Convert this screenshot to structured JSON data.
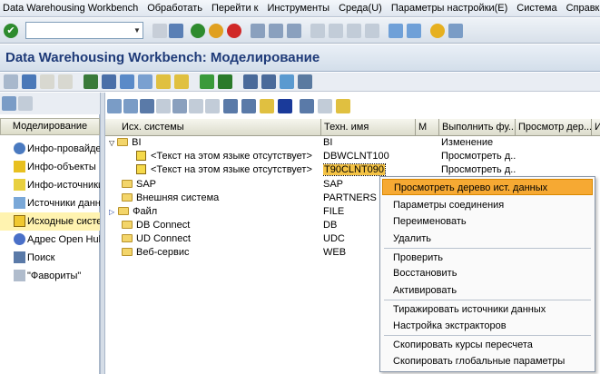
{
  "menu": [
    "Data Warehousing Workbench",
    "Обработать",
    "Перейти к",
    "Инструменты",
    "Среда(U)",
    "Параметры настройки(E)",
    "Система",
    "Справка"
  ],
  "toolbar": {
    "command_value": ""
  },
  "title": "Data Warehousing Workbench: Моделирование",
  "left": {
    "header": "Моделирование",
    "items": [
      "Инфо-провайдер",
      "Инфо-объекты",
      "Инфо-источники",
      "Источники данных",
      "Исходные системы",
      "Адрес Open Hub",
      "Поиск",
      "\"Фавориты\""
    ]
  },
  "grid": {
    "columns": [
      "Исх. системы",
      "Техн. имя",
      "М",
      "Выполнить фу...",
      "Просмотр дер...",
      "И"
    ],
    "rows": [
      {
        "name": "BI",
        "tech": "BI",
        "action": "Изменение"
      },
      {
        "name": "<Текст на этом языке отсутствует>",
        "tech": "DBWCLNT100",
        "action": "Просмотреть д..."
      },
      {
        "name": "<Текст на этом языке отсутствует>",
        "tech": "T90CLNT090",
        "action": "Просмотреть д..."
      },
      {
        "name": "SAP",
        "tech": "SAP",
        "action": ""
      },
      {
        "name": "Внешняя система",
        "tech": "PARTNERS",
        "action": ""
      },
      {
        "name": "Файл",
        "tech": "FILE",
        "action": ""
      },
      {
        "name": "DB Connect",
        "tech": "DB",
        "action": ""
      },
      {
        "name": "UD Connect",
        "tech": "UDC",
        "action": ""
      },
      {
        "name": "Веб-сервис",
        "tech": "WEB",
        "action": ""
      }
    ]
  },
  "context_menu": {
    "items": [
      "Просмотреть дерево ист. данных",
      "Параметры соединения",
      "Переименовать",
      "Удалить",
      "Проверить",
      "Восстановить",
      "Активировать",
      "Тиражировать источники данных",
      "Настройка экстракторов",
      "Скопировать курсы пересчета",
      "Скопировать глобальные параметры"
    ],
    "active_index": 0
  },
  "colors": {
    "title": "#1e3a78",
    "selection": "#f6a933",
    "folder": "#f3d56a"
  }
}
